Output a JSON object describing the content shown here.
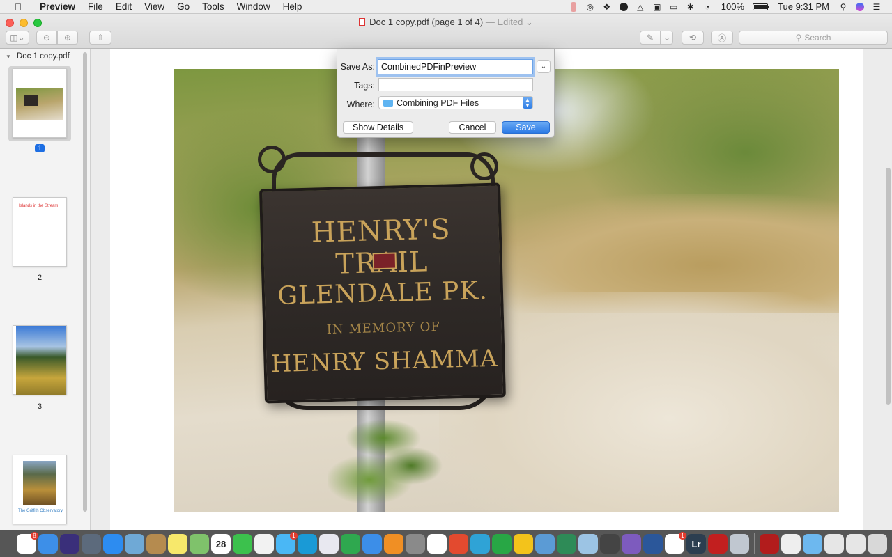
{
  "menubar": {
    "apple": "",
    "items": [
      "Preview",
      "File",
      "Edit",
      "View",
      "Go",
      "Tools",
      "Window",
      "Help"
    ],
    "battery_percent": "100%",
    "clock": "Tue 9:31 PM",
    "battery_level": 1.0
  },
  "window": {
    "title": "Doc 1 copy.pdf (page 1 of 4)",
    "edited": "— Edited",
    "search_placeholder": "Search"
  },
  "sidebar": {
    "document_name": "Doc 1 copy.pdf",
    "pages": [
      {
        "number": "1",
        "selected": true
      },
      {
        "number": "2",
        "selected": false,
        "text": "Islands in the Stream"
      },
      {
        "number": "3",
        "selected": false
      },
      {
        "number": "",
        "selected": false,
        "text": "The Griffith Observatory"
      }
    ]
  },
  "photo": {
    "sign_line1": "HENRY'S TRAIL",
    "sign_line2": "GLENDALE PK.",
    "sign_line3": "IN MEMORY OF",
    "sign_line4": "HENRY SHAMMA"
  },
  "dialog": {
    "save_as_label": "Save As:",
    "save_as_value": "CombinedPDFinPreview",
    "tags_label": "Tags:",
    "where_label": "Where:",
    "where_value": "Combining PDF Files",
    "show_details": "Show Details",
    "cancel": "Cancel",
    "save": "Save"
  },
  "dock": {
    "apps": [
      {
        "name": "chrome-icon",
        "color": "#ffffff",
        "badge": "8"
      },
      {
        "name": "finder-icon",
        "color": "#3d8fe8",
        "badge": ""
      },
      {
        "name": "siri-icon",
        "color": "#3a2f7a",
        "badge": ""
      },
      {
        "name": "launchpad-icon",
        "color": "#5c6a7c",
        "badge": ""
      },
      {
        "name": "safari-icon",
        "color": "#2d8cf0",
        "badge": ""
      },
      {
        "name": "preview-app-icon",
        "color": "#6fa9d6",
        "badge": ""
      },
      {
        "name": "notefile-icon",
        "color": "#b58b4f",
        "badge": ""
      },
      {
        "name": "stickies-icon",
        "color": "#f7e86b",
        "badge": ""
      },
      {
        "name": "maps-icon",
        "color": "#7fc26b",
        "badge": ""
      },
      {
        "name": "calendar-icon",
        "color": "#ffffff",
        "badge": "",
        "label": "28"
      },
      {
        "name": "facetime-icon",
        "color": "#3cc14d",
        "badge": ""
      },
      {
        "name": "photos-icon",
        "color": "#f2f2f2",
        "badge": ""
      },
      {
        "name": "messages-icon",
        "color": "#4ab7f5",
        "badge": "1"
      },
      {
        "name": "cleanmymac-icon",
        "color": "#1a9ad6",
        "badge": ""
      },
      {
        "name": "itunes-icon",
        "color": "#e8e8f0",
        "badge": ""
      },
      {
        "name": "numbers-icon",
        "color": "#2fa84f",
        "badge": ""
      },
      {
        "name": "keynote-icon",
        "color": "#3c8ee8",
        "badge": ""
      },
      {
        "name": "ibooks-icon",
        "color": "#f08f24",
        "badge": ""
      },
      {
        "name": "system-preferences-icon",
        "color": "#8a8a8a",
        "badge": ""
      },
      {
        "name": "chrome-alt-icon",
        "color": "#ffffff",
        "badge": ""
      },
      {
        "name": "wps-presentation-icon",
        "color": "#e34a2f",
        "badge": ""
      },
      {
        "name": "wps-writer-icon",
        "color": "#2fa3d6",
        "badge": ""
      },
      {
        "name": "wps-spreadsheet-icon",
        "color": "#28a745",
        "badge": ""
      },
      {
        "name": "o-app-icon",
        "color": "#f3c31b",
        "badge": ""
      },
      {
        "name": "teams-icon",
        "color": "#5b9bd5",
        "badge": ""
      },
      {
        "name": "globe-app-icon",
        "color": "#2e8b57",
        "badge": ""
      },
      {
        "name": "network-icon",
        "color": "#9cc4e4",
        "badge": ""
      },
      {
        "name": "podcast-icon",
        "color": "#444444",
        "badge": ""
      },
      {
        "name": "viber-icon",
        "color": "#7d5bbe",
        "badge": ""
      },
      {
        "name": "word-icon",
        "color": "#2b579a",
        "badge": ""
      },
      {
        "name": "slack-icon",
        "color": "#ffffff",
        "badge": "1"
      },
      {
        "name": "lightroom-icon",
        "color": "#2c3e50",
        "badge": "",
        "label": "Lr"
      },
      {
        "name": "acrobat-icon",
        "color": "#c21f1f",
        "badge": ""
      },
      {
        "name": "image-capture-icon",
        "color": "#c0c7d0",
        "badge": ""
      },
      {
        "name": "sep",
        "color": "",
        "badge": ""
      },
      {
        "name": "acrobat-doc-icon",
        "color": "#b21c1c",
        "badge": ""
      },
      {
        "name": "music-file-icon",
        "color": "#eeeeee",
        "badge": ""
      },
      {
        "name": "folder-icon",
        "color": "#6db8ef",
        "badge": ""
      },
      {
        "name": "downloads-icon",
        "color": "#e6e6e6",
        "badge": ""
      },
      {
        "name": "document-icon",
        "color": "#e6e6e6",
        "badge": ""
      },
      {
        "name": "trash-icon",
        "color": "#d8d8d8",
        "badge": ""
      }
    ]
  }
}
